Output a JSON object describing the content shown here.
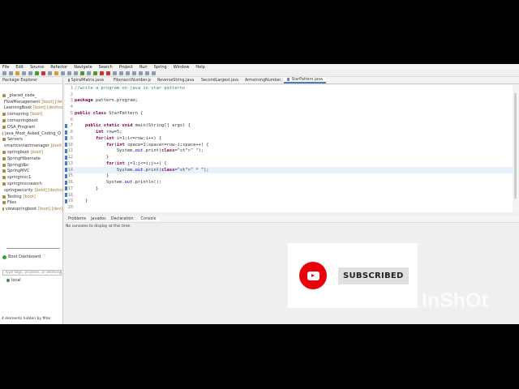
{
  "menu": [
    "File",
    "Edit",
    "Source",
    "Refactor",
    "Navigate",
    "Search",
    "Project",
    "Run",
    "Spring",
    "Window",
    "Help"
  ],
  "left_panel": {
    "title": "Package Explorer",
    "items": [
      {
        "name": "_placed_code_",
        "tag": ""
      },
      {
        "name": "FlowManagement",
        "tag": "[boot] [devtools]"
      },
      {
        "name": "LearningBook",
        "tag": "[boot] [devtools]"
      },
      {
        "name": "comspring",
        "tag": "[boot]"
      },
      {
        "name": "comspringboot",
        "tag": ""
      },
      {
        "name": "DSA_Program",
        "tag": ""
      },
      {
        "name": "Java_Most_Asked_Coding_Q",
        "tag": ""
      },
      {
        "name": "Servers",
        "tag": ""
      },
      {
        "name": "smartcontactmanager",
        "tag": "[boot]"
      },
      {
        "name": "springboot",
        "tag": "[boot]"
      },
      {
        "name": "SpringHibernate",
        "tag": ""
      },
      {
        "name": "SpringJdbc",
        "tag": ""
      },
      {
        "name": "SpringMVC",
        "tag": ""
      },
      {
        "name": "springmvc1",
        "tag": ""
      },
      {
        "name": "springmvcsearch",
        "tag": ""
      },
      {
        "name": "springsecurity",
        "tag": "[boot] [devtools]"
      },
      {
        "name": "Testing",
        "tag": "[boot]"
      },
      {
        "name": "Files",
        "tag": ""
      },
      {
        "name": "viewspringboot",
        "tag": "[boot] [dev]"
      }
    ]
  },
  "boot_dashboard": {
    "title": "Boot Dashboard",
    "filter_placeholder": "Type tags, projects, or working set names",
    "local": "local",
    "status": "4 elements hidden by filter"
  },
  "tabs": [
    "SpiralMatrix.java",
    "FibonacciNumber.java",
    "ReverseString.java",
    "SecondLargest.java",
    "ArmstrongNumber.java",
    "StarPattern.java"
  ],
  "code": [
    {
      "n": "1",
      "t": "//write a program on java in star patterns"
    },
    {
      "n": "2",
      "t": ""
    },
    {
      "n": "3",
      "t": "package pattern.program;"
    },
    {
      "n": "4",
      "t": ""
    },
    {
      "n": "5",
      "t": "public class StarPattern {"
    },
    {
      "n": "6",
      "t": ""
    },
    {
      "n": "7",
      "t": "    public static void main(String[] args) {"
    },
    {
      "n": "8",
      "t": "        int row=5;"
    },
    {
      "n": "9",
      "t": "        for(int i=1;i<=row;i++) {"
    },
    {
      "n": "10",
      "t": "            for(int space=1;space<=row-i;space++) {"
    },
    {
      "n": "11",
      "t": "                System.out.print(\" \");"
    },
    {
      "n": "12",
      "t": "            }"
    },
    {
      "n": "13",
      "t": "            for(int j=1;j<=i;j++) {"
    },
    {
      "n": "14",
      "t": "                System.out.print(\" * \");"
    },
    {
      "n": "15",
      "t": "            }"
    },
    {
      "n": "16",
      "t": "            System.out.println();"
    },
    {
      "n": "17",
      "t": "        }"
    },
    {
      "n": "18",
      "t": ""
    },
    {
      "n": "19",
      "t": "    }"
    },
    {
      "n": "20",
      "t": ""
    }
  ],
  "console": {
    "tabs": [
      "Problems",
      "Javadoc",
      "Declaration",
      "Console"
    ],
    "message": "No consoles to display at this time."
  },
  "overlay": {
    "subscribe": "SUBSCRIBED",
    "watermark": "InShOt",
    "accent": "#e8000b"
  }
}
